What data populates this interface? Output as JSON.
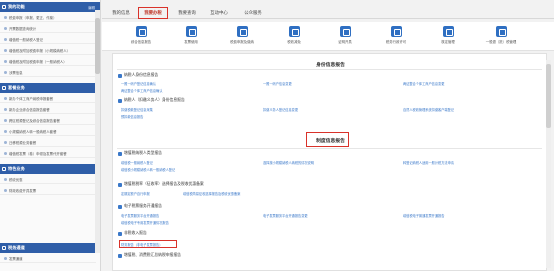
{
  "sidebar": {
    "sections": [
      {
        "title": "我的功能",
        "right": "编辑",
        "items": [
          "税费申报（申报、更正、作废）",
          "开票数据查询统计",
          "增值税一般纳税人登记",
          "增值税及附加税费申报（小规模纳税人）",
          "增值税及附加税费申报（一般纳税人）",
          "涉票信息"
        ]
      },
      {
        "title": "套餐业务",
        "items": [
          "新办个体工商户纳税申报套餐",
          "新办企业综合信息报告套餐",
          "跨区税源登记及综合信息报告套餐",
          "小规模纳税人转一般纳税人套餐",
          "迁移税源业务套餐",
          "增值税发票（卷）申领及发票代开套餐"
        ]
      },
      {
        "title": "特色业务",
        "items": [
          "税收优惠",
          "财政收费开具发票"
        ]
      },
      {
        "title": "税务通道",
        "items": [
          "发票通道"
        ]
      }
    ]
  },
  "tabs": [
    "我的信息",
    "我要办税",
    "我要查询",
    "互动中心",
    "公众服务"
  ],
  "active_tab": "我要办税",
  "toolbar": [
    "综合信息报告",
    "发票使用",
    "税费申报及缴纳",
    "税收减免",
    "证明开具",
    "税务行政许可",
    "核定管理",
    "一般退（抵）税管理"
  ],
  "panel": {
    "title1": "身份信息报告",
    "group1": "纳税人身份信息报告",
    "group1_links": [
      "一照一码户登记信息确认",
      "一照一码户信息变更",
      "两证整合个体工商户信息变更",
      "两证整合个体工商户信息确认"
    ],
    "group2": "纳税人（扣缴义务人）身份信息报告",
    "group2_links": [
      "扣缴税款登记信息采集",
      "扣缴义务人登记信息变更",
      "自然人税收管理系统扣缴客户端登记",
      "预扣款信息报告"
    ],
    "title2": "制度信息报告",
    "group3": "增值税纳税人类型报告",
    "group3_links": [
      "增值税一般纳税人登记",
      "选择按小规模纳税人纳税的情况说明",
      "转登记纳税人适用一般计税方法申请",
      "增值税小规模纳税人转一般纳税人登记"
    ],
    "group4": "增值税税率（征收率）选择报告及税收优惠备案",
    "group4_links": [
      "定期定额户自行申报",
      "增值税简易征收选择报告及税收优惠备案"
    ],
    "group5": "电子税票服务开通报告",
    "group5_links": [
      "电子发票服务平台开通报告",
      "电子发票服务平台开通报告变更",
      "增值税电子普通发票开通报告",
      "增值税电子专用发票开通情况报告"
    ],
    "group6": "非税收入报告",
    "group6_links": [
      "财务报告（非电子发票报告）"
    ],
    "group7": "增值税、消费税汇总纳税申报报告"
  }
}
